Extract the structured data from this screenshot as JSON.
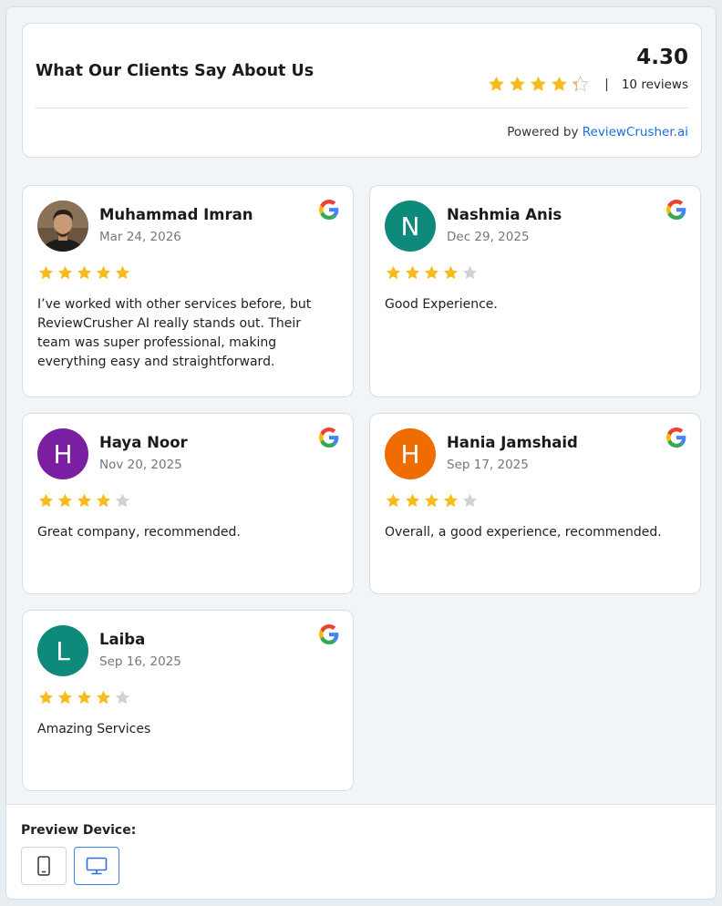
{
  "summary": {
    "title": "What Our Clients Say About Us",
    "score": "4.30",
    "rating_fraction": 0.86,
    "separator": "|",
    "count": "10 reviews",
    "powered_prefix": "Powered by",
    "powered_link": "ReviewCrusher.ai"
  },
  "colors": {
    "star_filled": "#f7bb1b",
    "star_empty": "#d1d1d1",
    "link": "#1a6fd8",
    "accent": "#3b7fe0"
  },
  "reviews": [
    {
      "name": "Muhammad Imran",
      "date": "Mar 24, 2026",
      "rating": 5,
      "text": "I’ve worked with other services before, but ReviewCrusher AI really stands out. Their team was super professional, making everything easy and straightforward.",
      "avatar_type": "photo",
      "initial": ""
    },
    {
      "name": "Nashmia Anis",
      "date": "Dec 29, 2025",
      "rating": 4,
      "text": "Good Experience.",
      "avatar_type": "initial",
      "initial": "N",
      "avatar_color": "#0e8a7a"
    },
    {
      "name": "Haya Noor",
      "date": "Nov 20, 2025",
      "rating": 4,
      "text": "Great company, recommended.",
      "avatar_type": "initial",
      "initial": "H",
      "avatar_color": "#7b1fa2"
    },
    {
      "name": "Hania Jamshaid",
      "date": "Sep 17, 2025",
      "rating": 4,
      "text": "Overall, a good experience, recommended.",
      "avatar_type": "initial",
      "initial": "H",
      "avatar_color": "#ef6c00"
    },
    {
      "name": "Laiba",
      "date": "Sep 16, 2025",
      "rating": 4,
      "text": "Amazing Services",
      "avatar_type": "initial",
      "initial": "L",
      "avatar_color": "#0e8a7a"
    }
  ],
  "preview": {
    "label": "Preview Device:",
    "devices": [
      {
        "icon": "smartphone-icon",
        "active": false
      },
      {
        "icon": "desktop-icon",
        "active": true
      }
    ]
  }
}
